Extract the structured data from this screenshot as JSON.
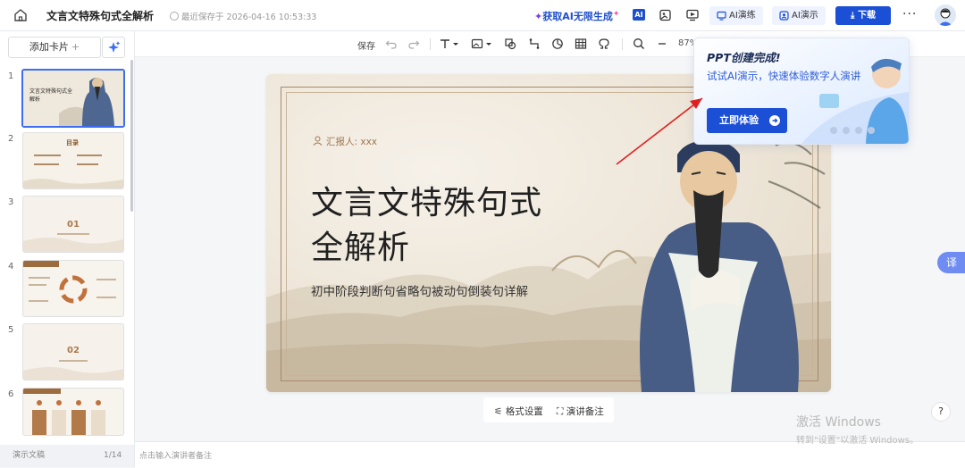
{
  "header": {
    "doc_title": "文言文特殊句式全解析",
    "save_status": "最近保存于 2026-04-16 10:53:33",
    "promo": "获取AI无限生成",
    "ai_badge": "AI",
    "ai_practice": "AI演练",
    "ai_present": "AI演示",
    "download": "下载",
    "more": "···"
  },
  "left_panel": {
    "add_card": "添加卡片",
    "slides": [
      {
        "num": "1",
        "title": "文言文特殊句式全解析"
      },
      {
        "num": "2",
        "title": "目录"
      },
      {
        "num": "3",
        "title": "01"
      },
      {
        "num": "4",
        "title": ""
      },
      {
        "num": "5",
        "title": "02"
      },
      {
        "num": "6",
        "title": ""
      }
    ],
    "footer_label": "演示文稿",
    "footer_count": "1/14"
  },
  "toolbar": {
    "save": "保存",
    "zoom": "87%"
  },
  "slide": {
    "presenter": "汇报人: xxx",
    "title_line1": "文言文特殊句式",
    "title_line2": "全解析",
    "subtitle": "初中阶段判断句省略句被动句倒装句详解"
  },
  "slide_actions": {
    "format": "格式设置",
    "notes": "演讲备注"
  },
  "popup": {
    "title": "PPT创建完成!",
    "subtitle": "试试AI演示，快速体验数字人演讲",
    "button": "立即体验"
  },
  "notes": {
    "placeholder": "点击输入演讲者备注"
  },
  "watermark": {
    "line1": "激活 Windows",
    "line2": "转到\"设置\"以激活 Windows。"
  },
  "help": "?",
  "translate": "译",
  "colors": {
    "accent": "#1b4fd6",
    "slide_bg": "#ece4d6",
    "arrow": "#e02020"
  }
}
